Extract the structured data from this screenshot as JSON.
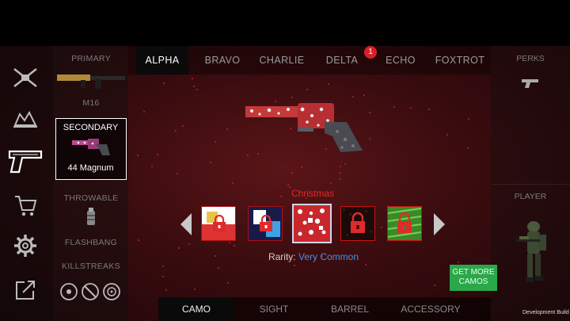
{
  "tabs": [
    "ALPHA",
    "BRAVO",
    "CHARLIE",
    "DELTA",
    "ECHO",
    "FOXTROT"
  ],
  "active_tab": "ALPHA",
  "delta_badge": "1",
  "slots": {
    "primary_label": "PRIMARY",
    "primary_weapon": "M16",
    "secondary_label": "SECONDARY",
    "secondary_weapon": "44 Magnum",
    "throwable_label": "THROWABLE",
    "throwable_item": "FLASHBANG",
    "killstreaks_label": "KILLSTREAKS"
  },
  "right": {
    "perks_label": "PERKS",
    "player_label": "PLAYER"
  },
  "camo": {
    "name": "Christmas",
    "rarity_label": "Rarity:",
    "rarity_value": "Very Common",
    "rarity_color": "#4a90e2",
    "name_color": "#e02a2a",
    "options": [
      "locked-camo-1",
      "locked-camo-2",
      "christmas-camo",
      "locked-camo-red",
      "locked-camo-green"
    ]
  },
  "get_more_label": "GET MORE CAMOS",
  "bottom_tabs": [
    "CAMO",
    "SIGHT",
    "BARREL",
    "ACCESSORY"
  ],
  "active_bottom_tab": "CAMO",
  "footer_text": "Development Build",
  "colors": {
    "accent_red": "#d8202a",
    "button_green": "#2aa84a"
  }
}
